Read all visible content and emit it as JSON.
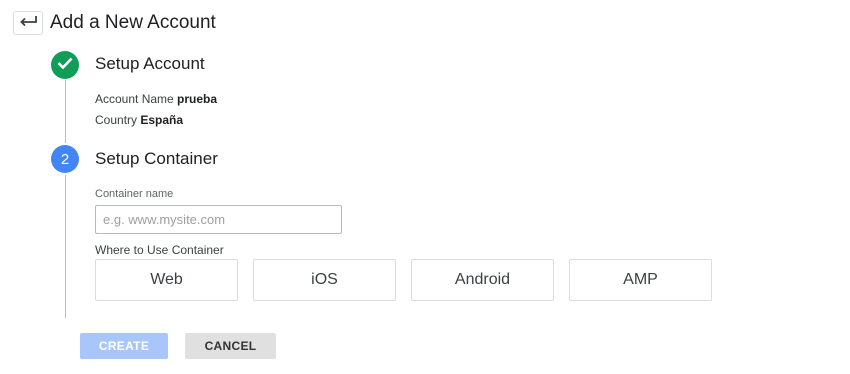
{
  "header": {
    "back_icon": "arrow-back-icon",
    "title": "Add a New Account"
  },
  "step1": {
    "icon": "checkmark-icon",
    "title": "Setup Account",
    "account_name_label": "Account Name",
    "account_name_value": "prueba",
    "country_label": "Country",
    "country_value": "España",
    "status_color": "#0f9d58"
  },
  "step2": {
    "number": "2",
    "title": "Setup Container",
    "container_name_label": "Container name",
    "container_name_value": "",
    "container_name_placeholder": "e.g. www.mysite.com",
    "where_label": "Where to Use Container",
    "platforms": [
      "Web",
      "iOS",
      "Android",
      "AMP"
    ],
    "status_color": "#4285f4"
  },
  "actions": {
    "create_label": "CREATE",
    "cancel_label": "CANCEL"
  }
}
